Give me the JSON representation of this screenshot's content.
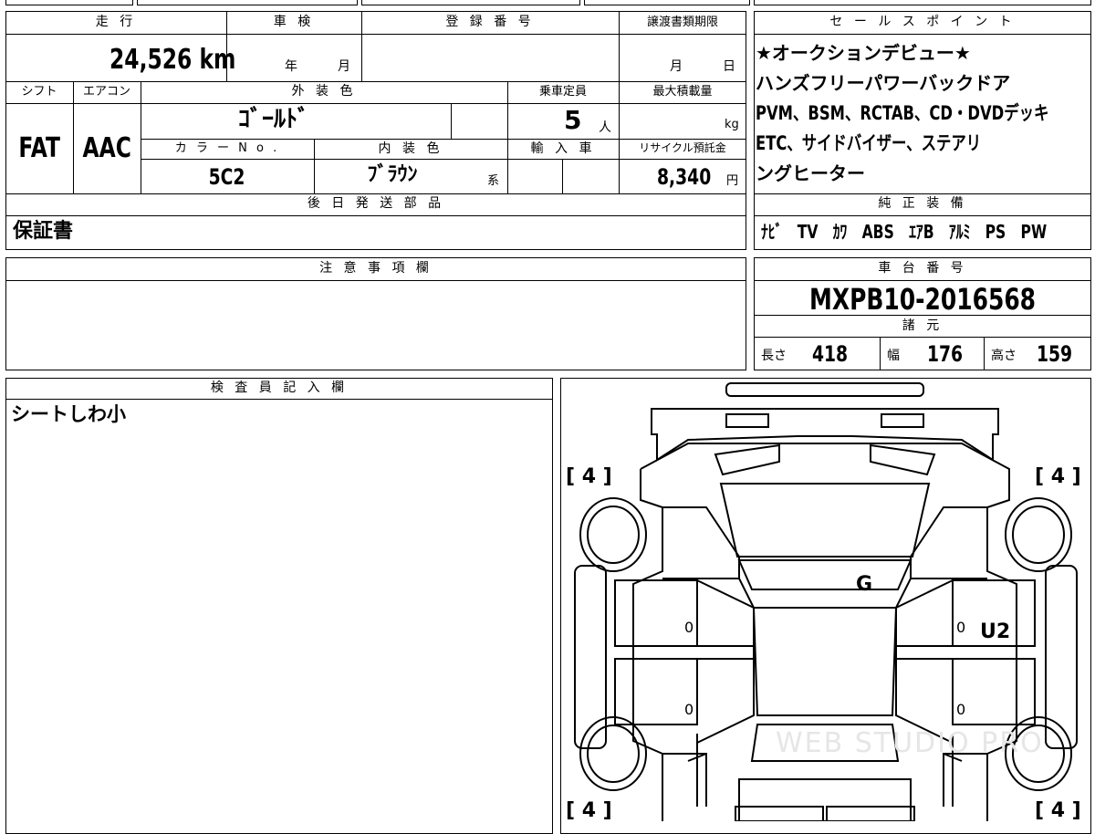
{
  "top": {
    "mileage_label": "走 行",
    "mileage_value": "24,526",
    "mileage_unit": "km",
    "inspection_label": "車 検",
    "inspection_year": "年",
    "inspection_month": "月",
    "registration_label": "登 録 番 号",
    "transfer_label": "譲渡書類期限",
    "transfer_month": "月",
    "transfer_day": "日",
    "shift_label": "シフト",
    "shift_value": "FAT",
    "ac_label": "エアコン",
    "ac_value": "AAC",
    "exterior_label": "外 装 色",
    "exterior_value": "ｺﾞｰﾙﾄﾞ",
    "capacity_label": "乗車定員",
    "capacity_value": "5",
    "capacity_unit": "人",
    "max_load_label": "最大積載量",
    "max_load_unit": "kg",
    "color_no_label": "カ ラ ー N o .",
    "color_no_value": "5C2",
    "interior_label": "内 装 色",
    "interior_value": "ﾌﾞﾗｳﾝ",
    "interior_suffix": "系",
    "import_label": "輸 入 車",
    "recycle_label": "リサイクル預託金",
    "recycle_value": "8,340",
    "recycle_unit": "円",
    "later_parts_label": "後 日 発 送 部 品",
    "later_parts_value": "保証書"
  },
  "sales": {
    "label": "セ ー ル ス ポ イ ン ト",
    "lines": [
      "★オークションデビュー★",
      "ハンズフリーパワーバックドア",
      "PVM、BSM、RCTAB、CD・DVDデッキ",
      "ETC、サイドバイザー、ステアリ",
      "ングヒーター"
    ]
  },
  "equipment": {
    "label": "純 正 装 備",
    "items": [
      "ﾅﾋﾞ",
      "TV",
      "ｶﾜ",
      "ABS",
      "ｴｱB",
      "ｱﾙﾐ",
      "PS",
      "PW"
    ]
  },
  "caution": {
    "label": "注 意 事 項 欄"
  },
  "chassis": {
    "label": "車 台 番 号",
    "value": "MXPB10-2016568"
  },
  "specs": {
    "label": "諸 元",
    "length_label": "長さ",
    "length_value": "418",
    "width_label": "幅",
    "width_value": "176",
    "height_label": "高さ",
    "height_value": "159"
  },
  "inspector": {
    "label": "検 査 員 記 入 欄",
    "note": "シートしわ小"
  },
  "diagram": {
    "tire_front_left": "[ 4 ]",
    "tire_front_right": "[ 4 ]",
    "tire_rear_left": "[ 4 ]",
    "tire_rear_right": "[ 4 ]",
    "mark_hood": "G",
    "mark_right_front_door": "U2",
    "zero_1": "0",
    "zero_2": "0",
    "zero_3": "0",
    "zero_4": "0",
    "watermark": "WEB STUDIO PRO"
  }
}
